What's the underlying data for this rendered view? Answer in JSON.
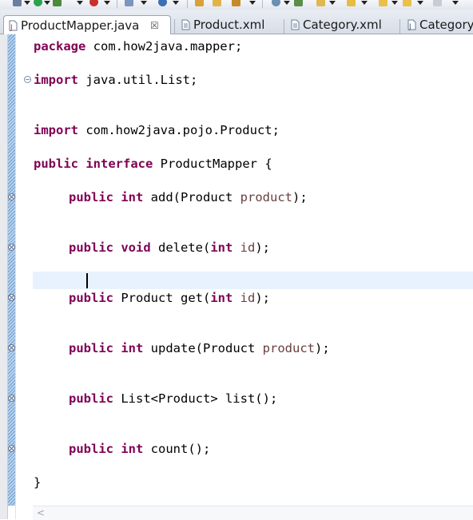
{
  "tabs": [
    {
      "label": "ProductMapper.java",
      "active": true,
      "icon": "java-file-icon",
      "close": "☒"
    },
    {
      "label": "Product.xml",
      "active": false,
      "icon": "xml-file-icon"
    },
    {
      "label": "Category.xml",
      "active": false,
      "icon": "xml-file-icon"
    },
    {
      "label": "Category",
      "active": false,
      "icon": "java-file-icon"
    }
  ],
  "code": {
    "line1": {
      "kw": "package",
      "rest": " com.how2java.mapper;"
    },
    "line2": {
      "kw": "import",
      "rest": " java.util.List;"
    },
    "line3": {
      "kw": "import",
      "rest": " com.how2java.pojo.Product;"
    },
    "line4": {
      "kw1": "public",
      "kw2": "interface",
      "rest": " ProductMapper {"
    },
    "line5": {
      "kw1": "public",
      "kw2": "int",
      "rest": " add(Product ",
      "param": "product",
      "end": ");"
    },
    "line6": {
      "kw1": "public",
      "kw2": "void",
      "rest": " delete(",
      "kw3": "int",
      "param": " id",
      "end": ");"
    },
    "line7": {
      "kw1": "public",
      "rest": " Product get(",
      "kw3": "int",
      "param": " id",
      "end": ");"
    },
    "line8": {
      "kw1": "public",
      "kw2": "int",
      "rest": " update(Product ",
      "param": "product",
      "end": ");"
    },
    "line9": {
      "kw1": "public",
      "rest": " List<Product> list();"
    },
    "line10": {
      "kw1": "public",
      "kw2": "int",
      "rest": " count();"
    },
    "line11": {
      "rest": "}"
    }
  },
  "colors": {
    "keyword": "#7f0055",
    "parameter": "#6a3e3e",
    "current_line": "#e8f2fe",
    "overview_ruler": "#8fb6de"
  },
  "scroll": {
    "left_arrow": "<"
  }
}
